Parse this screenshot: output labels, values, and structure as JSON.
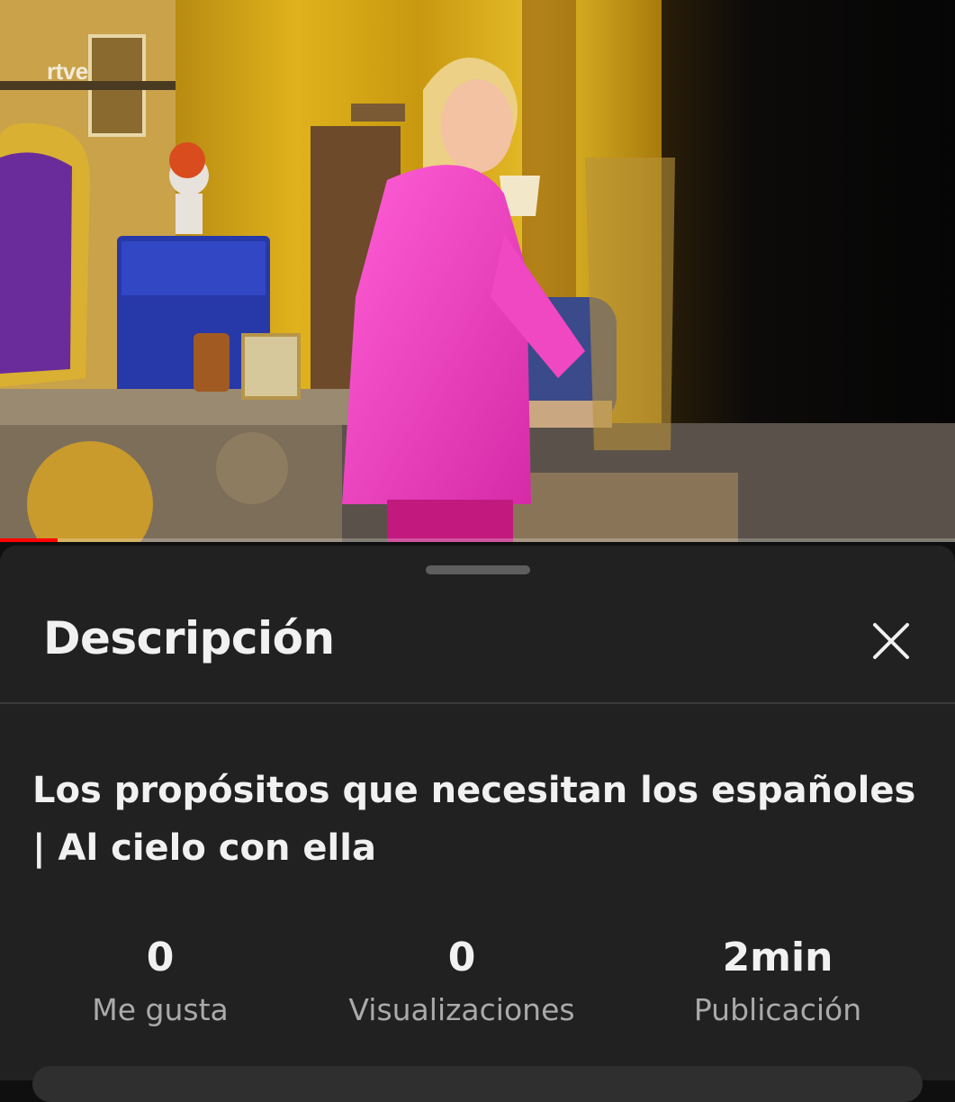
{
  "video": {
    "watermark": "rtve",
    "progress": 0.06,
    "accent_color": "#ff0000"
  },
  "sheet": {
    "title": "Descripción",
    "close_icon": "close-icon",
    "video_title": "Los propósitos que necesitan los españoles | Al cielo con ella",
    "stats": [
      {
        "value": "0",
        "label": "Me gusta"
      },
      {
        "value": "0",
        "label": "Visualizaciones"
      },
      {
        "value": "2min",
        "label": "Publicación"
      }
    ]
  }
}
